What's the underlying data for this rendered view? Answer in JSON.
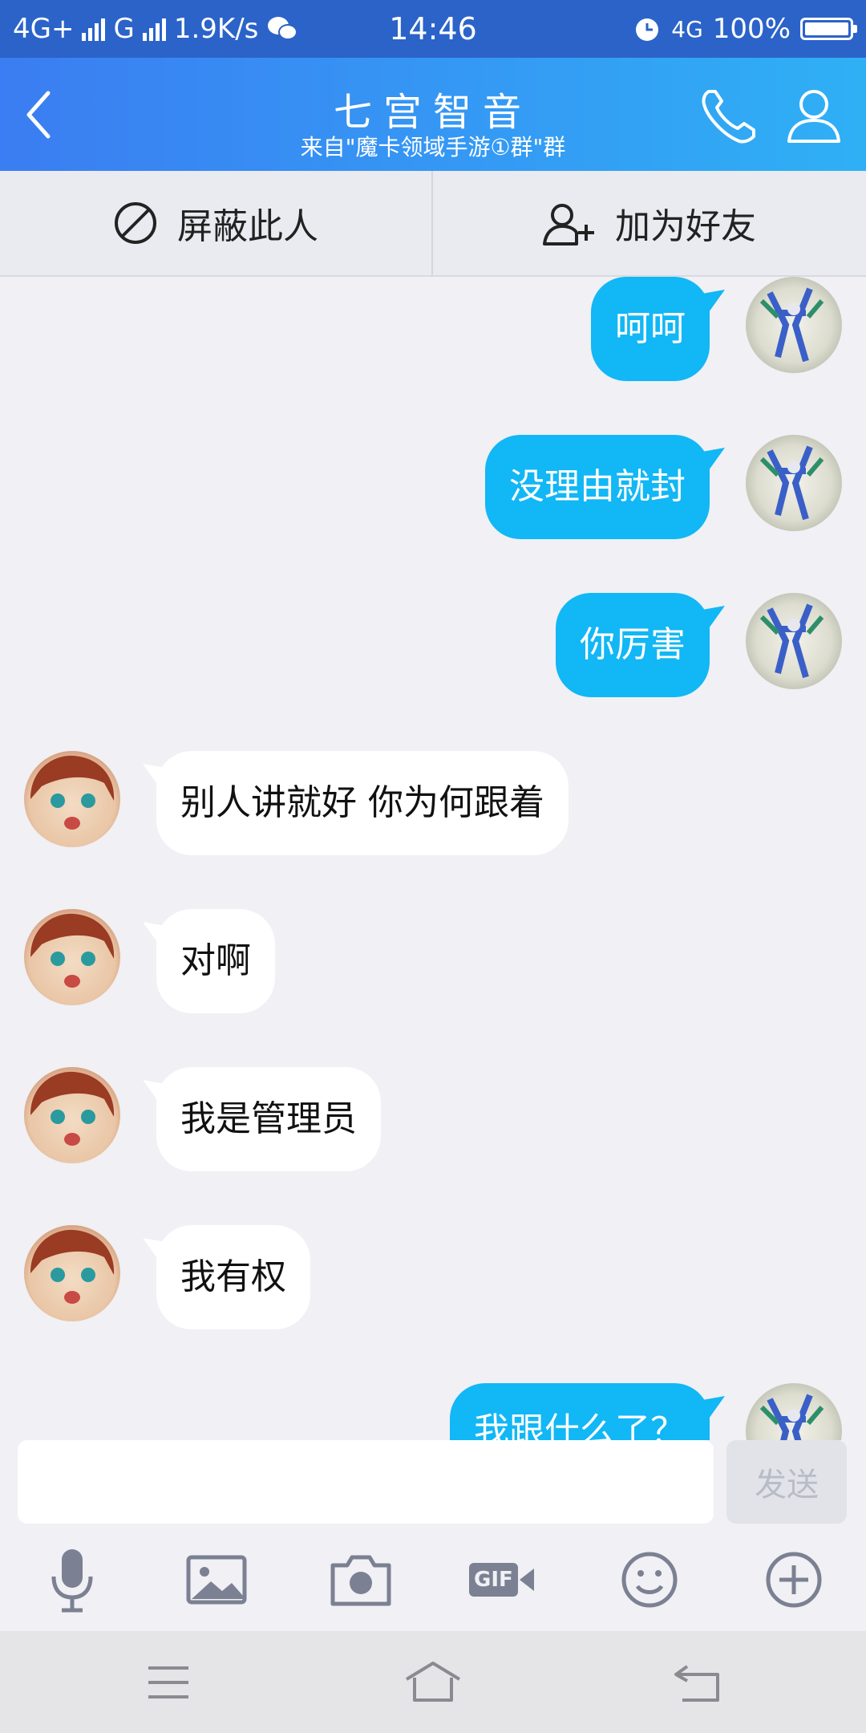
{
  "status_bar": {
    "network_left": "4G+",
    "network_g": "G",
    "speed": "1.9K/s",
    "time": "14:46",
    "network_right": "4G",
    "battery": "100%",
    "battery_level": 1.0
  },
  "header": {
    "contact_name": "七宫智音",
    "source": "来自\"魔卡领域手游①群\"群"
  },
  "actions": {
    "block_label": "屏蔽此人",
    "add_friend_label": "加为好友"
  },
  "messages": [
    {
      "side": "out",
      "text": "呵呵"
    },
    {
      "side": "out",
      "text": "没理由就封"
    },
    {
      "side": "out",
      "text": "你厉害"
    },
    {
      "side": "in",
      "text": "别人讲就好  你为何跟着"
    },
    {
      "side": "in",
      "text": "对啊"
    },
    {
      "side": "in",
      "text": "我是管理员"
    },
    {
      "side": "in",
      "text": "我有权"
    },
    {
      "side": "out",
      "text": "我跟什么了？"
    }
  ],
  "composer": {
    "input_value": "",
    "send_label": "发送"
  },
  "toolbar": {
    "gif_label": "GIF"
  },
  "colors": {
    "accent": "#12b7f5",
    "header_start": "#3b7df2",
    "header_end": "#2fb0f5"
  }
}
